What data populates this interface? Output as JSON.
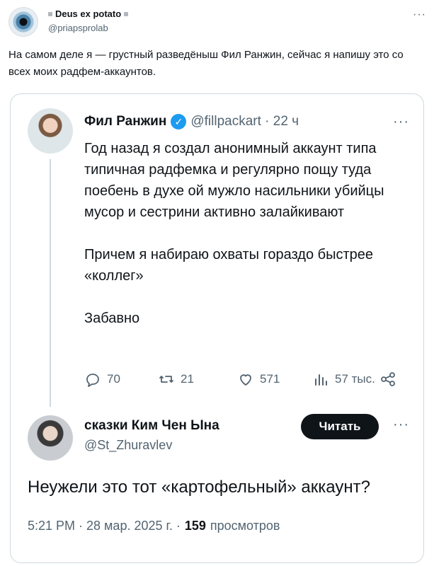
{
  "outer": {
    "name": "Deus ex potato",
    "handle": "@priapsprolab",
    "more": "···",
    "text": "На самом деле я — грустный разведёныш Фил Ранжин, сейчас я напишу это со всех моих радфем-аккаунтов."
  },
  "quoted": {
    "name": "Фил Ранжин",
    "verified_icon": "verified-badge-icon",
    "handle": "@fillpackart · 22 ч",
    "more": "···",
    "body": {
      "p1": "Год назад я создал анонимный аккаунт типа типичная радфемка и регулярно пощу туда поебень в духе ой мужло насильники убийцы мусор и сестрини активно залайкивают",
      "p2": "Причем я набираю охваты гораздо быстрее «коллег»",
      "p3": "Забавно"
    },
    "actions": {
      "replies": "70",
      "reposts": "21",
      "likes": "571",
      "views": "57 тыс."
    }
  },
  "reply": {
    "name": "сказки Ким Чен Ына",
    "handle": "@St_Zhuravlev",
    "read_button": "Читать",
    "more": "···",
    "text": "Неужели это тот «картофельный» аккаунт?",
    "meta": {
      "time": "5:21 PM · 28 мар. 2025 г. ·",
      "views_count": "159",
      "views_label": "просмотров"
    }
  },
  "colors": {
    "accent": "#1d9bf0",
    "text": "#0f1419",
    "secondary": "#536471",
    "border": "#cfd9de",
    "button_bg": "#0f1419"
  }
}
